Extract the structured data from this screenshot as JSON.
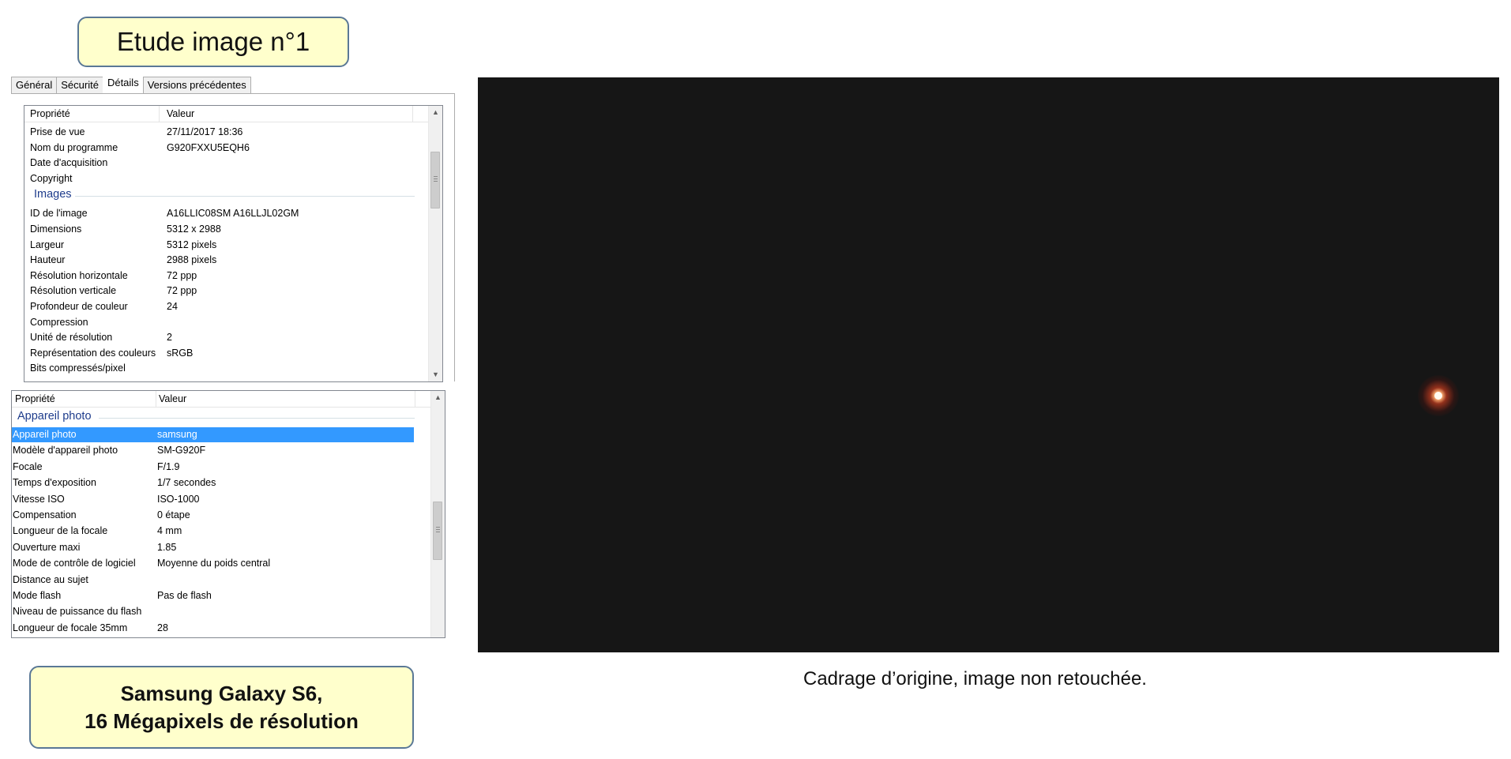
{
  "title": "Etude image n°1",
  "tabs": [
    "Général",
    "Sécurité",
    "Détails",
    "Versions précédentes"
  ],
  "grid1": {
    "headers": [
      "Propriété",
      "Valeur"
    ],
    "rows_top": [
      [
        "Prise de vue",
        "27/11/2017 18:36"
      ],
      [
        "Nom du programme",
        "G920FXXU5EQH6"
      ],
      [
        "Date d'acquisition",
        ""
      ],
      [
        "Copyright",
        ""
      ]
    ],
    "group": "Images",
    "rows_images": [
      [
        "ID de l'image",
        "A16LLIC08SM A16LLJL02GM"
      ],
      [
        "Dimensions",
        "5312 x 2988"
      ],
      [
        "Largeur",
        "5312 pixels"
      ],
      [
        "Hauteur",
        "2988 pixels"
      ],
      [
        "Résolution horizontale",
        "72 ppp"
      ],
      [
        "Résolution verticale",
        "72 ppp"
      ],
      [
        "Profondeur de couleur",
        "24"
      ],
      [
        "Compression",
        ""
      ],
      [
        "Unité de résolution",
        "2"
      ],
      [
        "Représentation des couleurs",
        "sRGB"
      ],
      [
        "Bits compressés/pixel",
        ""
      ]
    ]
  },
  "grid2": {
    "headers": [
      "Propriété",
      "Valeur"
    ],
    "group": "Appareil photo",
    "rows": [
      [
        "Appareil photo",
        "samsung"
      ],
      [
        "Modèle d'appareil photo",
        "SM-G920F"
      ],
      [
        "Focale",
        "F/1.9"
      ],
      [
        "Temps d'exposition",
        "1/7 secondes"
      ],
      [
        "Vitesse ISO",
        "ISO-1000"
      ],
      [
        "Compensation",
        "0 étape"
      ],
      [
        "Longueur de la focale",
        "4 mm"
      ],
      [
        "Ouverture maxi",
        "1.85"
      ],
      [
        "Mode de contrôle de logiciel",
        "Moyenne du poids central"
      ],
      [
        "Distance au sujet",
        ""
      ],
      [
        "Mode flash",
        "Pas de flash"
      ],
      [
        "Niveau de puissance du flash",
        ""
      ],
      [
        "Longueur de focale 35mm",
        "28"
      ]
    ],
    "selected_row": 0
  },
  "caption": {
    "line1": "Samsung Galaxy S6,",
    "line2": "16 Mégapixels de résolution"
  },
  "photo_caption": "Cadrage d’origine, image non retouchée.",
  "colors": {
    "callout_fill": "#ffffcc",
    "callout_border": "#5a7896",
    "selection": "#3399ff",
    "group_text": "#1e3c8c",
    "photo_bg": "#161616"
  }
}
